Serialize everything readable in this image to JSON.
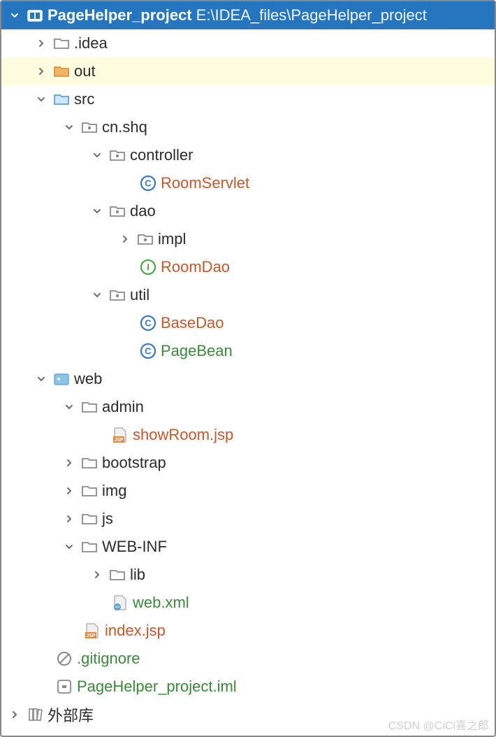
{
  "root": {
    "name": "PageHelper_project",
    "path": "E:\\IDEA_files\\PageHelper_project"
  },
  "tree": {
    "idea": ".idea",
    "out": "out",
    "src": "src",
    "cn_shq": "cn.shq",
    "controller": "controller",
    "roomServlet": "RoomServlet",
    "dao": "dao",
    "impl": "impl",
    "roomDao": "RoomDao",
    "util": "util",
    "baseDao": "BaseDao",
    "pageBean": "PageBean",
    "web": "web",
    "admin": "admin",
    "showRoom": "showRoom.jsp",
    "bootstrap": "bootstrap",
    "img": "img",
    "js": "js",
    "webinf": "WEB-INF",
    "lib": "lib",
    "webxml": "web.xml",
    "indexjsp": "index.jsp",
    "gitignore": ".gitignore",
    "iml": "PageHelper_project.iml",
    "external": "外部库"
  },
  "watermark": "CSDN @CiCi喜之郎"
}
